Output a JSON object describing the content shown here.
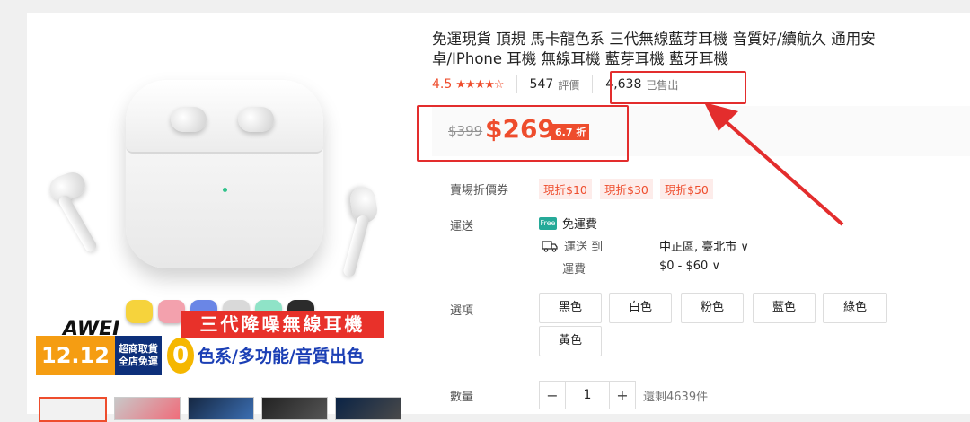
{
  "product": {
    "title": "免運現貨 頂規 馬卡龍色系 三代無線藍芽耳機 音質好/續航久 通用安卓/IPhone 耳機 無線耳機 藍芽耳機 藍牙耳機",
    "rating": "4.5",
    "stars": "★★★★☆",
    "review_count": "547",
    "review_label": "評價",
    "sold_count": "4,638",
    "sold_label": "已售出",
    "original_price": "$399",
    "price": "$269",
    "discount": "6.7 折"
  },
  "vouchers": {
    "label": "賣場折價券",
    "items": [
      "現折$10",
      "現折$30",
      "現折$50"
    ]
  },
  "shipping": {
    "label": "運送",
    "free_text": "免運費",
    "free_badge": "Free",
    "ship_to_label": "運送 到",
    "location": "中正區, 臺北市 ∨",
    "fee_label": "運費",
    "fee_value": "$0 - $60 ∨"
  },
  "options": {
    "label": "選項",
    "items": [
      "黑色",
      "白色",
      "粉色",
      "藍色",
      "綠色",
      "黃色"
    ]
  },
  "quantity": {
    "label": "數量",
    "minus": "−",
    "value": "1",
    "plus": "+",
    "stock": "還剩4639件"
  },
  "image": {
    "banner_title": "三代降噪無線耳機",
    "brand": "AWEI",
    "promo_date": "12.12",
    "promo_line1": "超商取貨",
    "promo_line2": "全店免運",
    "promo_zero": "0",
    "promo_sub": "色系/多功能/音質出色",
    "swatch_colors": [
      "#f6d33c",
      "#f3a1ad",
      "#6a86e6",
      "#d9d9d9",
      "#8fe3c7",
      "#2b2b2b"
    ]
  },
  "annotations": {
    "highlight_color": "#e32d2d",
    "accent_color": "#ee4d2d"
  }
}
